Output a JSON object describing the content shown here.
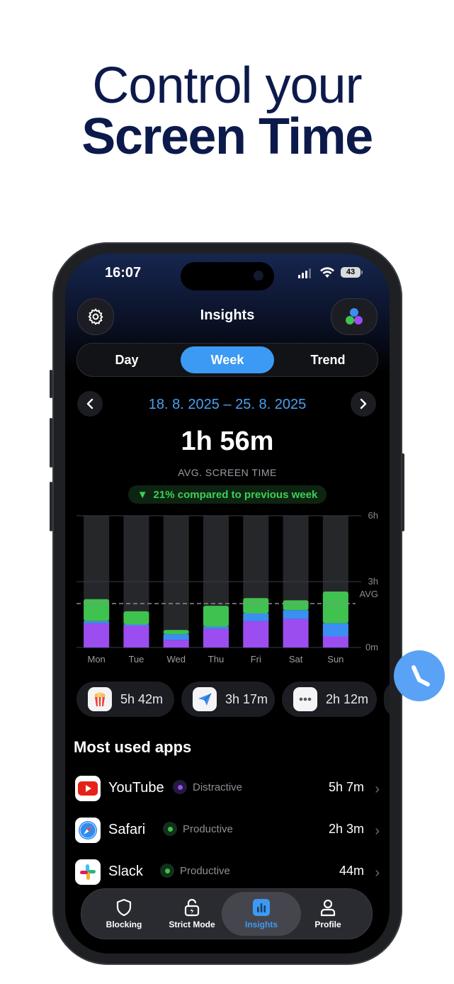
{
  "headline": {
    "line1": "Control your",
    "line2": "Screen Time"
  },
  "status_bar": {
    "time": "16:07",
    "battery": "43"
  },
  "header": {
    "title": "Insights",
    "settings_icon": "gear-icon",
    "profile_icon": "color-dots-icon"
  },
  "segments": {
    "items": [
      "Day",
      "Week",
      "Trend"
    ],
    "selected": "Week"
  },
  "date_range": "18. 8. 2025 – 25. 8. 2025",
  "summary": {
    "avg_time": "1h 56m",
    "avg_label": "AVG. SCREEN TIME",
    "comparison": "21% compared to previous week",
    "comparison_arrow": "▼"
  },
  "chart_data": {
    "type": "bar",
    "stacked": true,
    "categories": [
      "Mon",
      "Tue",
      "Wed",
      "Thu",
      "Fri",
      "Sat",
      "Sun"
    ],
    "series": [
      {
        "color": "#9b4df0",
        "values": [
          1.1,
          1.0,
          0.35,
          0.85,
          1.2,
          1.3,
          0.5
        ]
      },
      {
        "color": "#3b8ef2",
        "values": [
          0.1,
          0.05,
          0.25,
          0.1,
          0.35,
          0.4,
          0.6
        ]
      },
      {
        "color": "#3fc24f",
        "values": [
          1.0,
          0.6,
          0.2,
          0.95,
          0.7,
          0.45,
          1.45
        ]
      }
    ],
    "ylim": [
      0,
      6
    ],
    "ytick_labels": [
      "0m",
      "3h",
      "6h"
    ],
    "avg_line": 2.0,
    "avg_label": "AVG",
    "colors": {
      "track": "#26272b",
      "grid": "#3a3b40"
    }
  },
  "category_chips": [
    {
      "icon": "popcorn-icon",
      "time": "5h 42m"
    },
    {
      "icon": "paper-plane-icon",
      "time": "3h 17m"
    },
    {
      "icon": "more-dots-icon",
      "time": "2h 12m"
    }
  ],
  "most_used": {
    "title": "Most used apps",
    "apps": [
      {
        "name": "YouTube",
        "category": "Distractive",
        "time": "5h 7m",
        "dot_color": "#9b4df0"
      },
      {
        "name": "Safari",
        "category": "Productive",
        "time": "2h 3m",
        "dot_color": "#3fc24f"
      },
      {
        "name": "Slack",
        "category": "Productive",
        "time": "44m",
        "dot_color": "#3fc24f"
      }
    ]
  },
  "tabbar": {
    "items": [
      {
        "label": "Blocking",
        "icon": "shield-icon"
      },
      {
        "label": "Strict Mode",
        "icon": "lock-bolt-icon"
      },
      {
        "label": "Insights",
        "icon": "bar-chart-icon"
      },
      {
        "label": "Profile",
        "icon": "person-icon"
      }
    ],
    "selected": "Insights"
  },
  "accent_color": "#3c9af4"
}
